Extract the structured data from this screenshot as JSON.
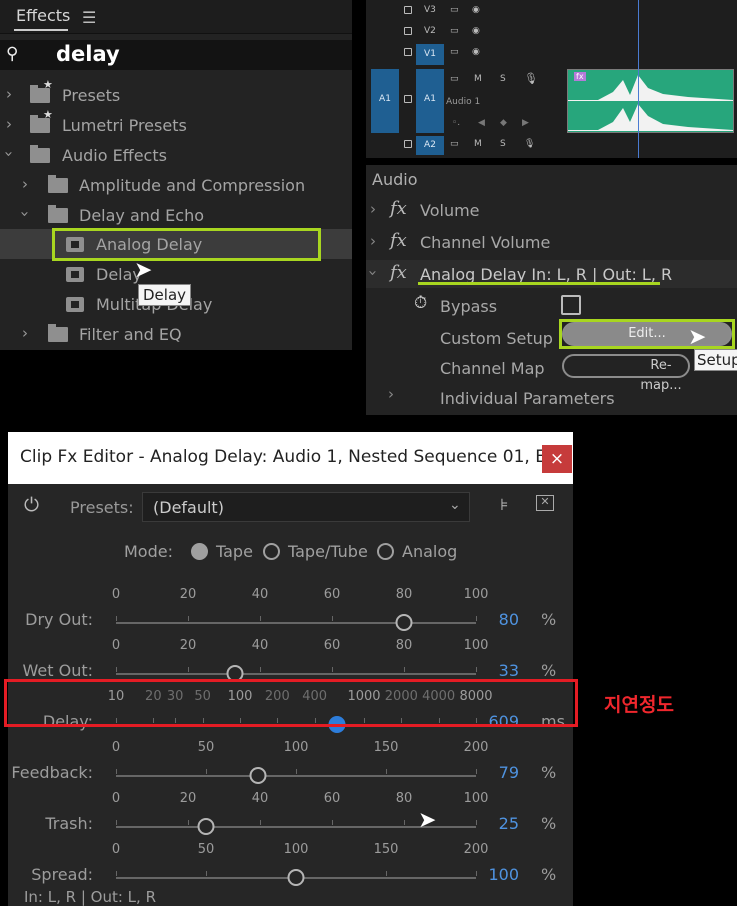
{
  "effects_panel": {
    "tab_label": "Effects",
    "search_value": "delay",
    "tree": [
      {
        "label": "Presets"
      },
      {
        "label": "Lumetri Presets"
      },
      {
        "label": "Audio Effects"
      },
      {
        "label": "Amplitude and Compression"
      },
      {
        "label": "Delay and Echo"
      },
      {
        "label": "Analog Delay"
      },
      {
        "label": "Delay"
      },
      {
        "label": "Multitap Delay"
      },
      {
        "label": "Filter and EQ"
      }
    ],
    "tooltip": "Delay"
  },
  "timeline": {
    "tracks": {
      "v3": "V3",
      "v2": "V2",
      "v1": "V1",
      "a1_source": "A1",
      "a1": "A1",
      "a1_name": "Audio 1",
      "a2": "A2",
      "m": "M",
      "s": "S"
    },
    "fx_badge": "fx"
  },
  "effect_controls": {
    "header": "Audio",
    "fx_symbol": "fx",
    "rows": {
      "volume": "Volume",
      "channel_volume": "Channel Volume",
      "analog_delay": "Analog Delay In: L, R | Out: L, R",
      "bypass": "Bypass",
      "custom_setup": "Custom Setup",
      "channel_map": "Channel Map",
      "individual_parameters": "Individual Parameters"
    },
    "edit_button": "Edit...",
    "remap_button": "Re-map...",
    "setup_tooltip": "Setup"
  },
  "editor": {
    "title": "Clip Fx Editor - Analog Delay: Audio 1, Nested Sequence 01, E...",
    "close": "×",
    "presets_label": "Presets:",
    "presets_value": "(Default)",
    "mode_label": "Mode:",
    "mode_options": [
      "Tape",
      "Tape/Tube",
      "Analog"
    ],
    "mode_selected": "Tape",
    "sliders": [
      {
        "label": "Dry Out:",
        "ticks": [
          "0",
          "20",
          "40",
          "60",
          "80",
          "100"
        ],
        "min": 0,
        "max": 100,
        "value": 80,
        "value_text": "80",
        "unit": "%"
      },
      {
        "label": "Wet Out:",
        "ticks": [
          "0",
          "20",
          "40",
          "60",
          "80",
          "100"
        ],
        "min": 0,
        "max": 100,
        "value": 33,
        "value_text": "33",
        "unit": "%"
      },
      {
        "label": "Delay:",
        "ticks": [
          "10",
          "20",
          "30",
          "50",
          "100",
          "200",
          "400",
          "1000",
          "2000",
          "4000",
          "8000"
        ],
        "min": 10,
        "max": 8000,
        "log": true,
        "value": 609,
        "value_text": "609",
        "unit": "ms"
      },
      {
        "label": "Feedback:",
        "ticks": [
          "0",
          "50",
          "100",
          "150",
          "200"
        ],
        "min": 0,
        "max": 200,
        "value": 79,
        "value_text": "79",
        "unit": "%"
      },
      {
        "label": "Trash:",
        "ticks": [
          "0",
          "20",
          "40",
          "60",
          "80",
          "100"
        ],
        "min": 0,
        "max": 100,
        "value": 25,
        "value_text": "25",
        "unit": "%"
      },
      {
        "label": "Spread:",
        "ticks": [
          "0",
          "50",
          "100",
          "150",
          "200"
        ],
        "min": 0,
        "max": 200,
        "value": 100,
        "value_text": "100",
        "unit": "%"
      }
    ],
    "footer": "In: L, R | Out: L, R"
  },
  "annotation": "지연정도",
  "colors": {
    "highlight_green": "#a8d620",
    "highlight_red": "#e41c24",
    "value_blue": "#4f93e0",
    "clip_green": "#27a67c"
  }
}
